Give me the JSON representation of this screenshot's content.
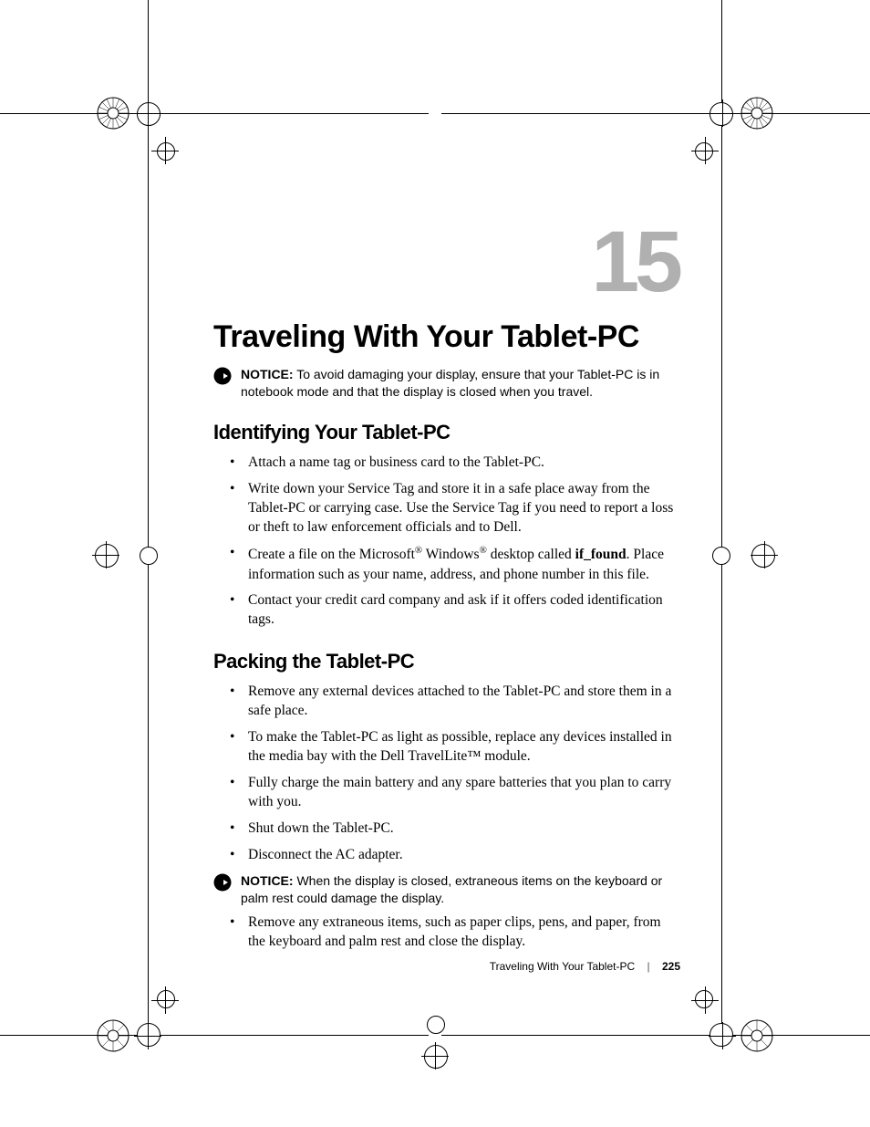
{
  "chapter_number": "15",
  "title": "Traveling With Your Tablet-PC",
  "notice1": {
    "label": "NOTICE:",
    "text": "To avoid damaging your display, ensure that your Tablet-PC is in notebook mode and that the display is closed when you travel."
  },
  "section1": {
    "heading": "Identifying Your Tablet-PC",
    "bullets": [
      "Attach a name tag or business card to the Tablet-PC.",
      "Write down your Service Tag and store it in a safe place away from the Tablet-PC or carrying case. Use the Service Tag if you need to report a loss or theft to law enforcement officials and to Dell.",
      {
        "pre": "Create a file on the Microsoft",
        "sup1": "®",
        "mid1": " Windows",
        "sup2": "®",
        "mid2": " desktop called ",
        "bold": "if_found",
        "post": ". Place information such as your name, address, and phone number in this file."
      },
      "Contact your credit card company and ask if it offers coded identification tags."
    ]
  },
  "section2": {
    "heading": "Packing the Tablet-PC",
    "bullets_a": [
      "Remove any external devices attached to the Tablet-PC and store them in a safe place.",
      "To make the Tablet-PC as light as possible, replace any devices installed in the media bay with the Dell TravelLite™ module.",
      "Fully charge the main battery and any spare batteries that you plan to carry with you.",
      "Shut down the Tablet-PC.",
      "Disconnect the AC adapter."
    ],
    "notice2": {
      "label": "NOTICE:",
      "text": "When the display is closed, extraneous items on the keyboard or palm rest could damage the display."
    },
    "bullets_b": [
      "Remove any extraneous items, such as paper clips, pens, and paper, from the keyboard and palm rest and close the display."
    ]
  },
  "footer": {
    "text": "Traveling With Your Tablet-PC",
    "page": "225"
  }
}
